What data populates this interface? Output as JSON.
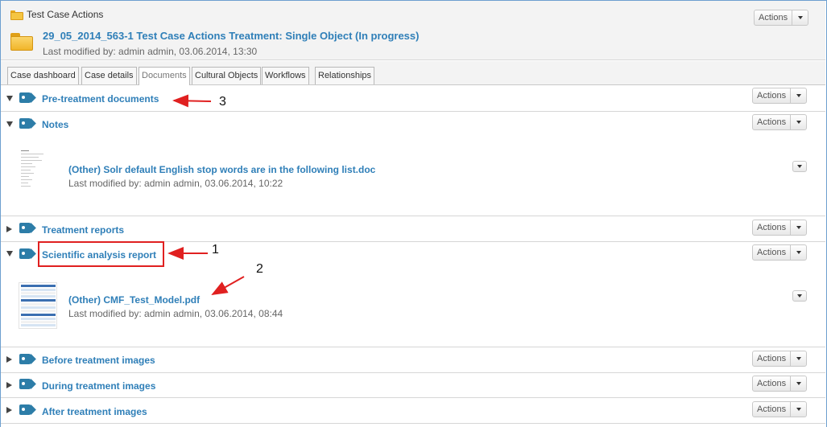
{
  "header": {
    "breadcrumb": "Test Case Actions",
    "title": "29_05_2014_563-1 Test Case Actions Treatment: Single Object (In progress)",
    "meta": "Last modified by: admin admin, 03.06.2014, 13:30",
    "actions_label": "Actions"
  },
  "tabs": [
    {
      "label": "Case dashboard"
    },
    {
      "label": "Case details"
    },
    {
      "label": "Documents",
      "active": true
    },
    {
      "label": "Cultural Objects"
    },
    {
      "label": "Workflows"
    },
    {
      "label": "Relationships"
    }
  ],
  "sections": [
    {
      "title": "Pre-treatment documents",
      "expanded": true,
      "actions_label": "Actions"
    },
    {
      "title": "Notes",
      "expanded": true,
      "actions_label": "Actions",
      "document": {
        "name": "(Other) Solr default English stop words are in the following list.doc",
        "meta": "Last modified by: admin admin, 03.06.2014, 10:22"
      }
    },
    {
      "title": "Treatment reports",
      "expanded": false,
      "actions_label": "Actions"
    },
    {
      "title": "Scientific analysis report",
      "expanded": true,
      "actions_label": "Actions",
      "document": {
        "name": "(Other) CMF_Test_Model.pdf",
        "meta": "Last modified by: admin admin, 03.06.2014, 08:44"
      }
    },
    {
      "title": "Before treatment images",
      "expanded": false,
      "actions_label": "Actions"
    },
    {
      "title": "During treatment images",
      "expanded": false,
      "actions_label": "Actions"
    },
    {
      "title": "After treatment images",
      "expanded": false,
      "actions_label": "Actions"
    }
  ],
  "annotations": {
    "one": "1",
    "two": "2",
    "three": "3",
    "color": "#e02020"
  },
  "colors": {
    "link": "#2f7fb8",
    "tag": "#2d7da8",
    "folder": "#f5c542"
  }
}
